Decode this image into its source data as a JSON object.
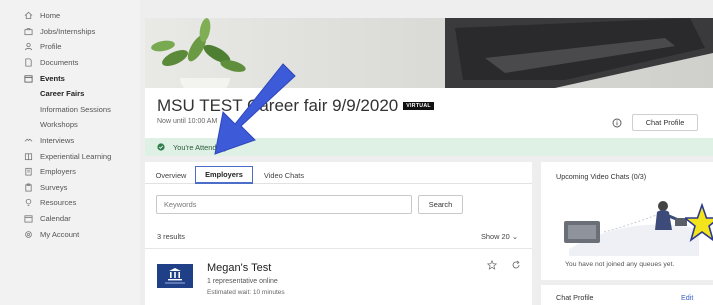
{
  "sidebar": {
    "items": [
      {
        "label": "Home",
        "icon": "home-icon"
      },
      {
        "label": "Jobs/Internships",
        "icon": "briefcase-icon"
      },
      {
        "label": "Profile",
        "icon": "person-icon"
      },
      {
        "label": "Documents",
        "icon": "document-icon"
      },
      {
        "label": "Events",
        "icon": "calendar-events-icon"
      },
      {
        "label": "Career Fairs",
        "sub": true
      },
      {
        "label": "Information Sessions",
        "sub": true
      },
      {
        "label": "Workshops",
        "sub": true
      },
      {
        "label": "Interviews",
        "icon": "handshake-icon"
      },
      {
        "label": "Experiential Learning",
        "icon": "learning-icon"
      },
      {
        "label": "Employers",
        "icon": "building-icon"
      },
      {
        "label": "Surveys",
        "icon": "clipboard-icon"
      },
      {
        "label": "Resources",
        "icon": "lightbulb-icon"
      },
      {
        "label": "Calendar",
        "icon": "calendar-icon"
      },
      {
        "label": "My Account",
        "icon": "gear-icon"
      }
    ]
  },
  "event": {
    "title": "MSU TEST Career fair 9/9/2020",
    "badge": "VIRTUAL",
    "subtitle": "Now until 10:00 AM",
    "chat_profile_button": "Chat Profile",
    "attending": "You're Attending"
  },
  "tabs": [
    {
      "label": "Overview"
    },
    {
      "label": "Employers"
    },
    {
      "label": "Video Chats"
    }
  ],
  "search": {
    "placeholder": "Keywords",
    "button": "Search"
  },
  "results": {
    "count": "3 results",
    "show": "Show 20 ⌄"
  },
  "employer": {
    "name": "Megan's Test",
    "reps": "1 representative online",
    "wait": "Estimated wait: 10 minutes"
  },
  "video_chats": {
    "title": "Upcoming Video Chats (0/3)",
    "empty": "You have not joined any queues yet."
  },
  "chat_profile": {
    "title": "Chat Profile",
    "edit": "Edit"
  },
  "colors": {
    "accent": "#4c6ec9",
    "attending_bg": "#dff0e4",
    "arrow": "#3d5bd9",
    "star": "#f4e41c"
  }
}
